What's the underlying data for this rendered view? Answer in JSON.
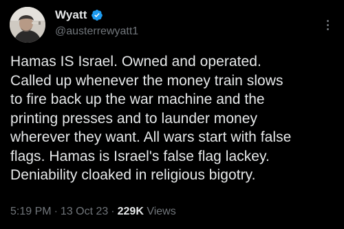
{
  "author": {
    "display_name": "Wyatt",
    "handle": "@austerrewyatt1",
    "verified_icon": "verified-badge-icon",
    "badge_color": "#1d9bf0"
  },
  "tweet": {
    "text": "Hamas IS Israel. Owned and operated.\nCalled up whenever the money train slows\nto fire back up the war machine and the\nprinting presses and to launder money\nwherever they want. All wars start with false\nflags. Hamas is Israel's false flag lackey.\nDeniability cloaked in religious bigotry."
  },
  "meta": {
    "time": "5:19 PM",
    "separator": "·",
    "date": "13 Oct 23",
    "separator2": "·",
    "views_count": "229K",
    "views_label": "Views"
  },
  "colors": {
    "background": "#000000",
    "text": "#e7e9ea",
    "muted": "#71767b"
  }
}
